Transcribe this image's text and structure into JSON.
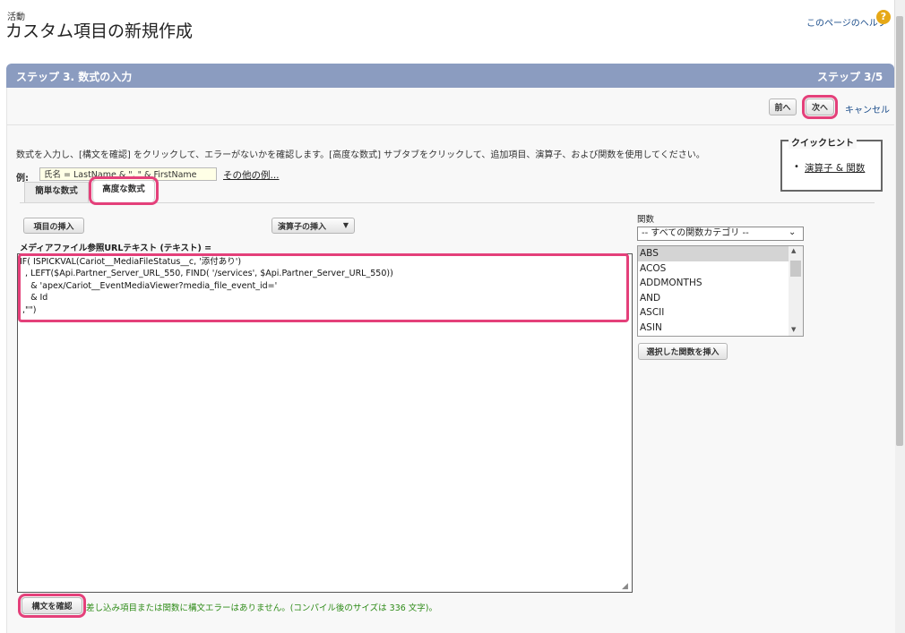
{
  "header": {
    "section_label": "活動",
    "page_title": "カスタム項目の新規作成",
    "help_link": "このページのヘルプ",
    "help_icon": "?"
  },
  "step": {
    "title": "ステップ 3. 数式の入力",
    "count": "ステップ 3/5"
  },
  "nav": {
    "prev_label": "前へ",
    "next_label": "次へ",
    "cancel_label": "キャンセル"
  },
  "instructions": "数式を入力し、[構文を確認] をクリックして、エラーがないかを確認します。[高度な数式] サブタブをクリックして、追加項目、演算子、および関数を使用してください。",
  "example": {
    "label": "例:",
    "value": "氏名 = LastName & \", \" & FirstName",
    "more_link": "その他の例..."
  },
  "quick_hint": {
    "title": "クイックヒント",
    "link": "演算子 & 関数"
  },
  "tabs": [
    {
      "label": "簡単な数式"
    },
    {
      "label": "高度な数式"
    }
  ],
  "editor": {
    "insert_field_label": "項目の挿入",
    "insert_operator_label": "演算子の挿入",
    "field_label": "メディアファイル参照URLテキスト (テキスト) =",
    "formula": "IF( ISPICKVAL(Cariot__MediaFileStatus__c, '添付あり')\n  , LEFT($Api.Partner_Server_URL_550, FIND( '/services', $Api.Partner_Server_URL_550))\n    & 'apex/Cariot__EventMediaViewer?media_file_event_id='\n    & Id\n ,\"\")"
  },
  "functions": {
    "label": "関数",
    "category_selected": "-- すべての関数カテゴリ --",
    "items": [
      "ABS",
      "ACOS",
      "ADDMONTHS",
      "AND",
      "ASCII",
      "ASIN"
    ],
    "insert_label": "選択した関数を挿入"
  },
  "syntax": {
    "check_label": "構文を確認",
    "result": "差し込み項目または関数に構文エラーはありません。(コンパイル後のサイズは 336 文字)。"
  },
  "colors": {
    "header_bar": "#8b9cc0",
    "highlight": "#e4407a",
    "success_text": "#2e8b18",
    "link": "#1a4c8a"
  }
}
